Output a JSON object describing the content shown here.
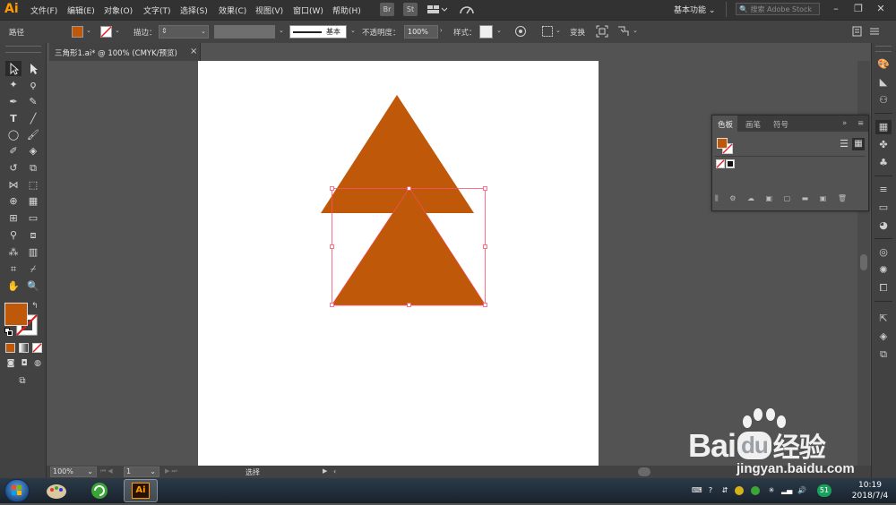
{
  "app": {
    "logo": "Ai",
    "menu": [
      "文件(F)",
      "编辑(E)",
      "对象(O)",
      "文字(T)",
      "选择(S)",
      "效果(C)",
      "视图(V)",
      "窗口(W)",
      "帮助(H)"
    ],
    "bridge_label": "Br",
    "stock_label": "St",
    "workspace": "基本功能",
    "search_placeholder": "搜索 Adobe Stock"
  },
  "control_bar": {
    "selection_type": "路径",
    "stroke_label": "描边",
    "stroke_style": "基本",
    "opacity_label": "不透明度",
    "opacity_value": "100%",
    "style_label": "样式",
    "transform_label": "变换",
    "fill_color": "#c0580a"
  },
  "document": {
    "tab_title": "三角形1.ai* @ 100% (CMYK/预览)",
    "close_glyph": "×"
  },
  "artwork": {
    "fill_color": "#c0580a",
    "selection_color": "#ff4f6e"
  },
  "swatches_panel": {
    "tabs": [
      "色板",
      "画笔",
      "符号"
    ],
    "active_tab": "色板",
    "menu_glyph": "»"
  },
  "status_bar": {
    "zoom": "100%",
    "artboard_number": "1",
    "tool_status": "选择"
  },
  "taskbar": {
    "time": "10:19",
    "date": "2018/7/4",
    "ai_label": "Ai",
    "badge": "51"
  },
  "watermark": {
    "brand": "Bai",
    "brand_du": "du",
    "cn": "经验",
    "url": "jingyan.baidu.com"
  }
}
